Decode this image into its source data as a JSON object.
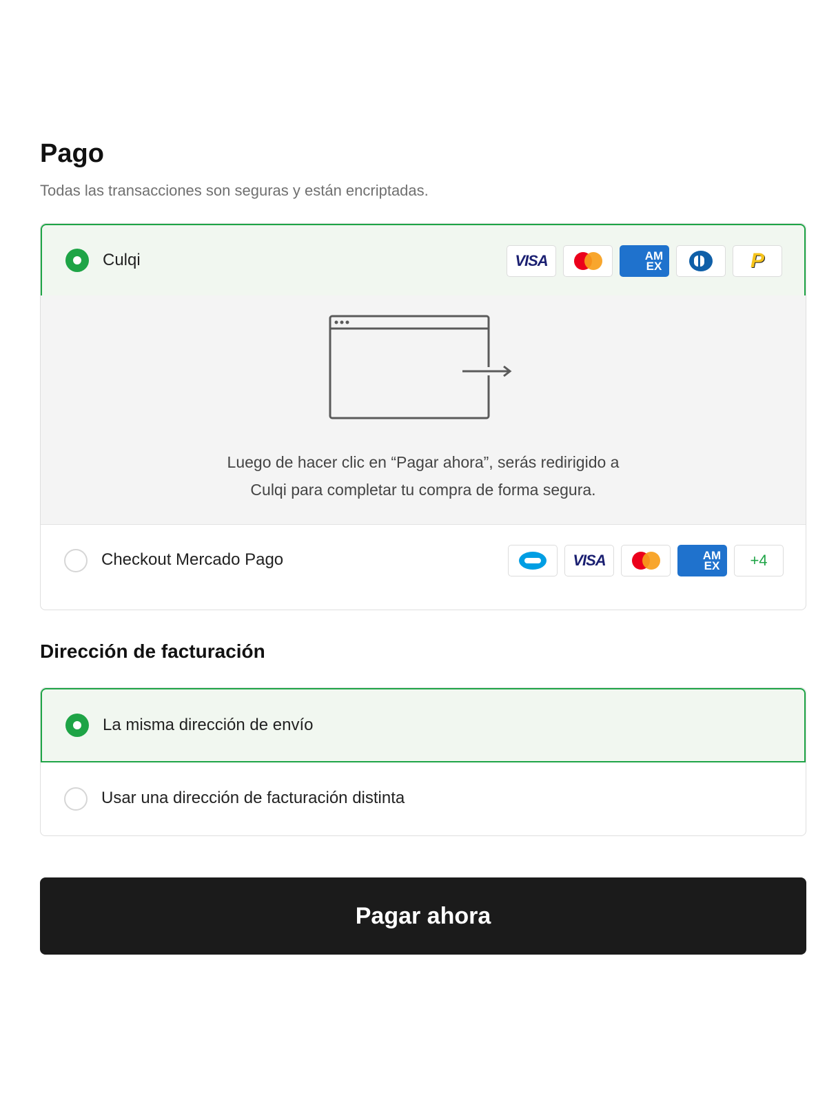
{
  "payment": {
    "title": "Pago",
    "subtitle": "Todas las transacciones son seguras y están encriptadas.",
    "options": [
      {
        "label": "Culqi",
        "selected": true,
        "cards": [
          "visa",
          "mastercard",
          "amex",
          "diners",
          "pagoefectivo"
        ],
        "card_text": {
          "visa": "VISA",
          "amex": "AM EX",
          "pagoefectivo": "P"
        }
      },
      {
        "label": "Checkout Mercado Pago",
        "selected": false,
        "cards": [
          "mercadopago",
          "visa",
          "mastercard",
          "amex",
          "more"
        ],
        "card_text": {
          "visa": "VISA",
          "amex": "AM EX",
          "more": "+4"
        }
      }
    ],
    "redirect_text_line1": "Luego de hacer clic en “Pagar ahora”, serás redirigido a",
    "redirect_text_line2": "Culqi para completar tu compra de forma segura."
  },
  "billing": {
    "title": "Dirección de facturación",
    "options": [
      {
        "label": "La misma dirección de envío",
        "selected": true
      },
      {
        "label": "Usar una dirección de facturación distinta",
        "selected": false
      }
    ]
  },
  "submit": {
    "label": "Pagar ahora"
  },
  "colors": {
    "accent": "#1ea446",
    "selected_bg": "#f1f7f0",
    "button_bg": "#1b1b1b",
    "panel_bg": "#f4f4f4"
  }
}
